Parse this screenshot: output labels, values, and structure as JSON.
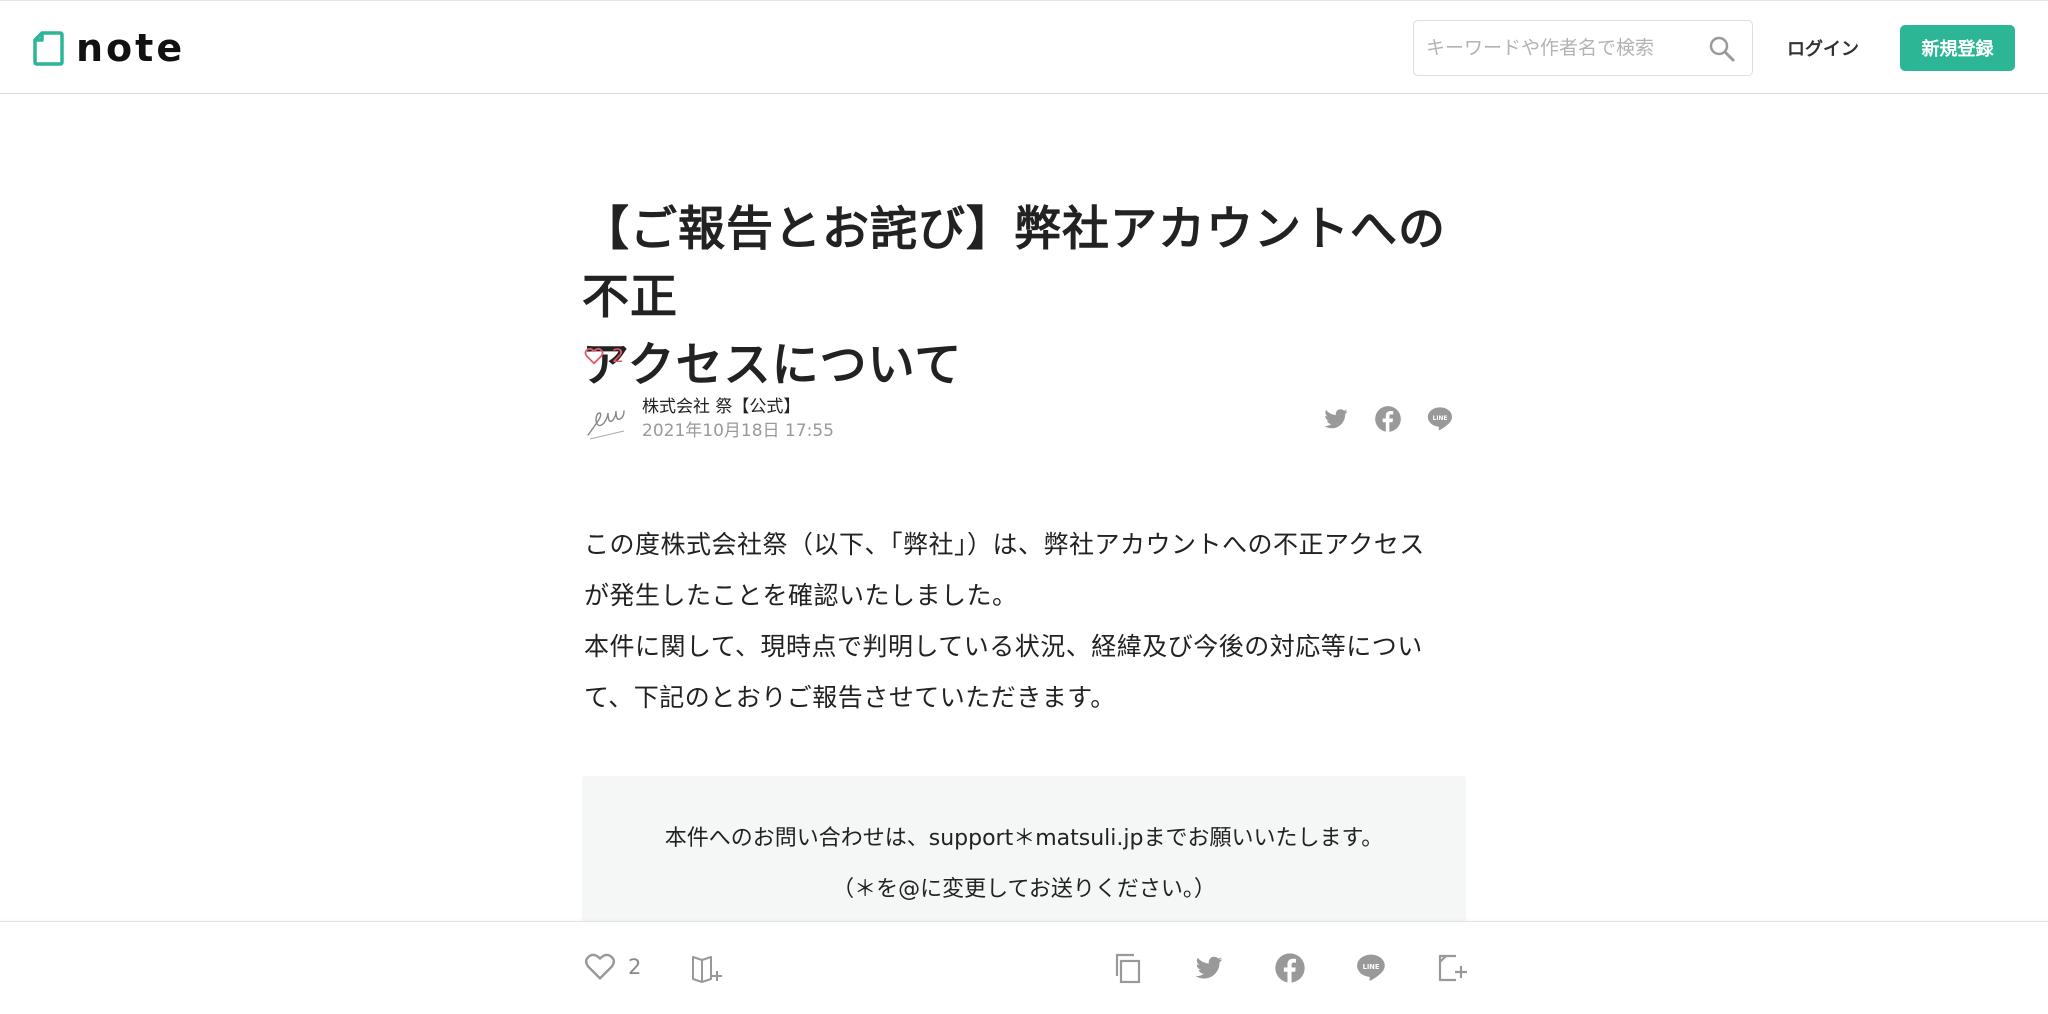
{
  "header": {
    "logo_text": "note",
    "search_placeholder": "キーワードや作者名で検索",
    "login_label": "ログイン",
    "signup_label": "新規登録",
    "brand_color": "#2cb696"
  },
  "article": {
    "title_line1": "【ご報告とお詫び】弊社アカウントへの不正",
    "title_line2": "アクセスについて",
    "like_count": "2",
    "author_name": "株式会社 祭【公式】",
    "published_at": "2021年10月18日 17:55",
    "paragraphs": [
      "この度株式会社祭（以下、「弊社」）は、弊社アカウントへの不正アクセス",
      "が発生したことを確認いたしました。",
      "本件に関して、現時点で判明している状況、経緯及び今後の対応等につい",
      "て、下記のとおりご報告させていただきます。"
    ],
    "notice_line1": "本件へのお問い合わせは、support＊matsuli.jpまでお願いいたします。",
    "notice_line2": "（＊を@に変更してお送りください。）"
  },
  "footer_bar": {
    "like_count": "2"
  },
  "icons": {
    "logo": "note-logo-icon",
    "search": "search-icon",
    "heart": "heart-icon",
    "twitter": "twitter-icon",
    "facebook": "facebook-icon",
    "line": "line-icon",
    "copy": "copy-icon",
    "magazine": "magazine-add-icon",
    "embed": "embed-icon"
  }
}
